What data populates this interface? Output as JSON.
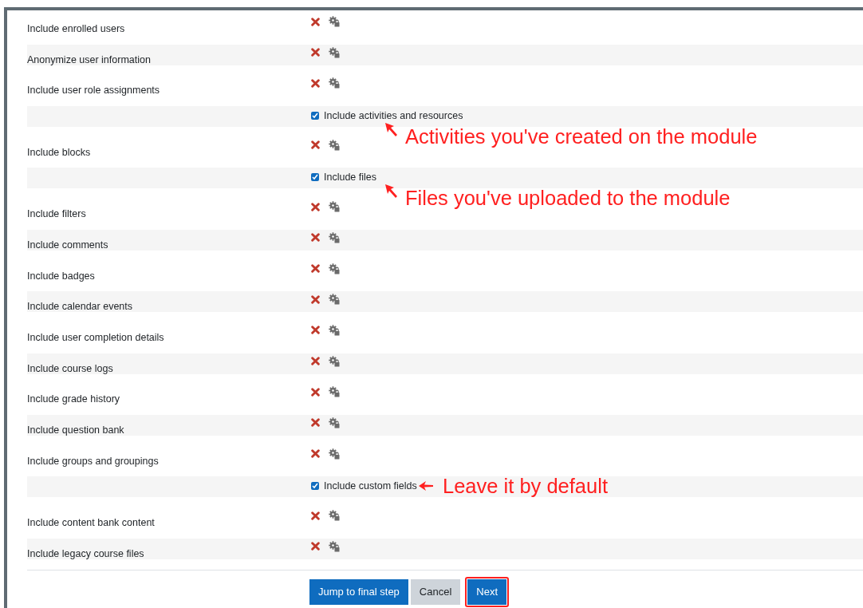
{
  "settings": [
    {
      "kind": "setting",
      "label": "Include enrolled users"
    },
    {
      "kind": "setting",
      "label": "Anonymize user information"
    },
    {
      "kind": "setting",
      "label": "Include user role assignments"
    },
    {
      "kind": "checkbox",
      "label": "Include activities and resources",
      "checked": true,
      "annotation": {
        "kind": "below",
        "text": "Activities you've created on the module"
      }
    },
    {
      "kind": "setting",
      "label": "Include blocks"
    },
    {
      "kind": "checkbox",
      "label": "Include files",
      "checked": true,
      "annotation": {
        "kind": "below",
        "text": "Files you've uploaded to the module"
      }
    },
    {
      "kind": "setting",
      "label": "Include filters"
    },
    {
      "kind": "setting",
      "label": "Include comments"
    },
    {
      "kind": "setting",
      "label": "Include badges"
    },
    {
      "kind": "setting",
      "label": "Include calendar events"
    },
    {
      "kind": "setting",
      "label": "Include user completion details"
    },
    {
      "kind": "setting",
      "label": "Include course logs"
    },
    {
      "kind": "setting",
      "label": "Include grade history"
    },
    {
      "kind": "setting",
      "label": "Include question bank"
    },
    {
      "kind": "setting",
      "label": "Include groups and groupings"
    },
    {
      "kind": "checkbox",
      "label": "Include custom fields",
      "checked": true,
      "annotation": {
        "kind": "beside",
        "text": "Leave it by default"
      }
    },
    {
      "kind": "setting",
      "label": "Include content bank content"
    },
    {
      "kind": "setting",
      "label": "Include legacy course files"
    }
  ],
  "buttons": [
    {
      "label": "Jump to final step",
      "kind": "primary",
      "highlighted": false
    },
    {
      "label": "Cancel",
      "kind": "secondary",
      "highlighted": false
    },
    {
      "label": "Next",
      "kind": "primary",
      "highlighted": true
    }
  ]
}
